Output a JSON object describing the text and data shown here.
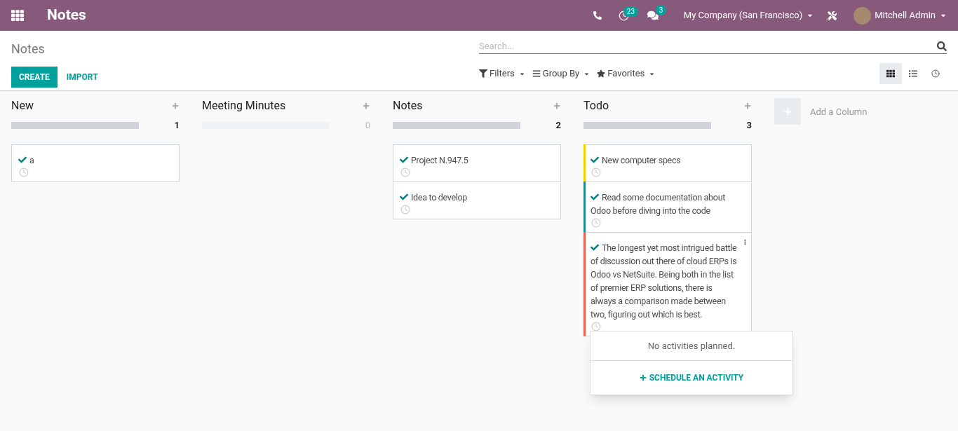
{
  "navbar": {
    "app_title": "Notes",
    "activity_count": "23",
    "message_count": "3",
    "company": "My Company (San Francisco)",
    "user": "Mitchell Admin"
  },
  "control_panel": {
    "breadcrumb": "Notes",
    "search": {
      "placeholder": "Search..."
    },
    "create_label": "CREATE",
    "import_label": "IMPORT",
    "filters": [
      {
        "kind": "filter",
        "label": "Filters"
      },
      {
        "kind": "group",
        "label": "Group By"
      },
      {
        "kind": "favorite",
        "label": "Favorites"
      }
    ],
    "views": [
      {
        "kind": "kanban",
        "selected": true
      },
      {
        "kind": "list",
        "selected": false
      },
      {
        "kind": "activity",
        "selected": false
      }
    ]
  },
  "columns": [
    {
      "title": "New",
      "count": "1",
      "empty": false,
      "cards": [
        {
          "text": "a"
        }
      ]
    },
    {
      "title": "Meeting Minutes",
      "count": "0",
      "empty": true
    },
    {
      "title": "Notes",
      "count": "2",
      "empty": false,
      "cards": [
        {
          "text": "Project N.947.5"
        },
        {
          "text": "Idea to develop"
        }
      ]
    },
    {
      "title": "Todo",
      "count": "3",
      "empty": false,
      "cards": [
        {
          "text": "New computer specs",
          "color": "#f0d000"
        },
        {
          "text": "Read some documentation about Odoo before diving into the code",
          "color": "#1f8a8f"
        },
        {
          "text": "The longest yet most intrigued battle of discussion out there of cloud ERPs is Odoo vs NetSuite. Being both in the list of premier ERP solutions, there is always a comparison made between two, figuring out which is best.",
          "color": "#f06050",
          "menu": true,
          "popover": {
            "message": "No activities planned.",
            "action": "SCHEDULE AN ACTIVITY"
          }
        }
      ]
    }
  ],
  "add_column_label": "Add a Column"
}
